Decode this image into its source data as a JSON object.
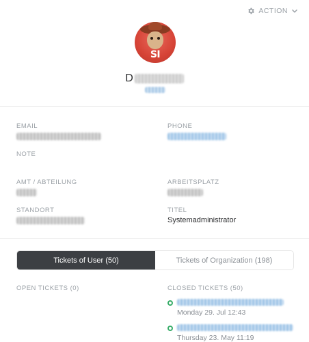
{
  "header": {
    "action_label": "ACTION",
    "avatar_initials": "SI",
    "name_visible_prefix": "D"
  },
  "fields": {
    "email_label": "EMAIL",
    "phone_label": "PHONE",
    "note_label": "NOTE",
    "amt_label": "AMT / ABTEILUNG",
    "arbeitsplatz_label": "ARBEITSPLATZ",
    "standort_label": "STANDORT",
    "titel_label": "TITEL",
    "titel_value": "Systemadministrator"
  },
  "tabs": [
    {
      "label": "Tickets of User (50)",
      "active": true
    },
    {
      "label": "Tickets of Organization (198)",
      "active": false
    }
  ],
  "tickets": {
    "open_label": "OPEN TICKETS (0)",
    "closed_label": "CLOSED TICKETS (50)",
    "closed_items": [
      {
        "time": "Monday 29. Jul 12:43"
      },
      {
        "time": "Thursday 23. May 11:19"
      }
    ]
  },
  "colors": {
    "accent_dark": "#3c3f43",
    "status_closed": "#38ad69",
    "label_gray": "#9aa0a6"
  },
  "icons": {
    "action": "gear-icon",
    "action_caret": "chevron-down-icon",
    "ticket_status": "status-circle-icon"
  }
}
